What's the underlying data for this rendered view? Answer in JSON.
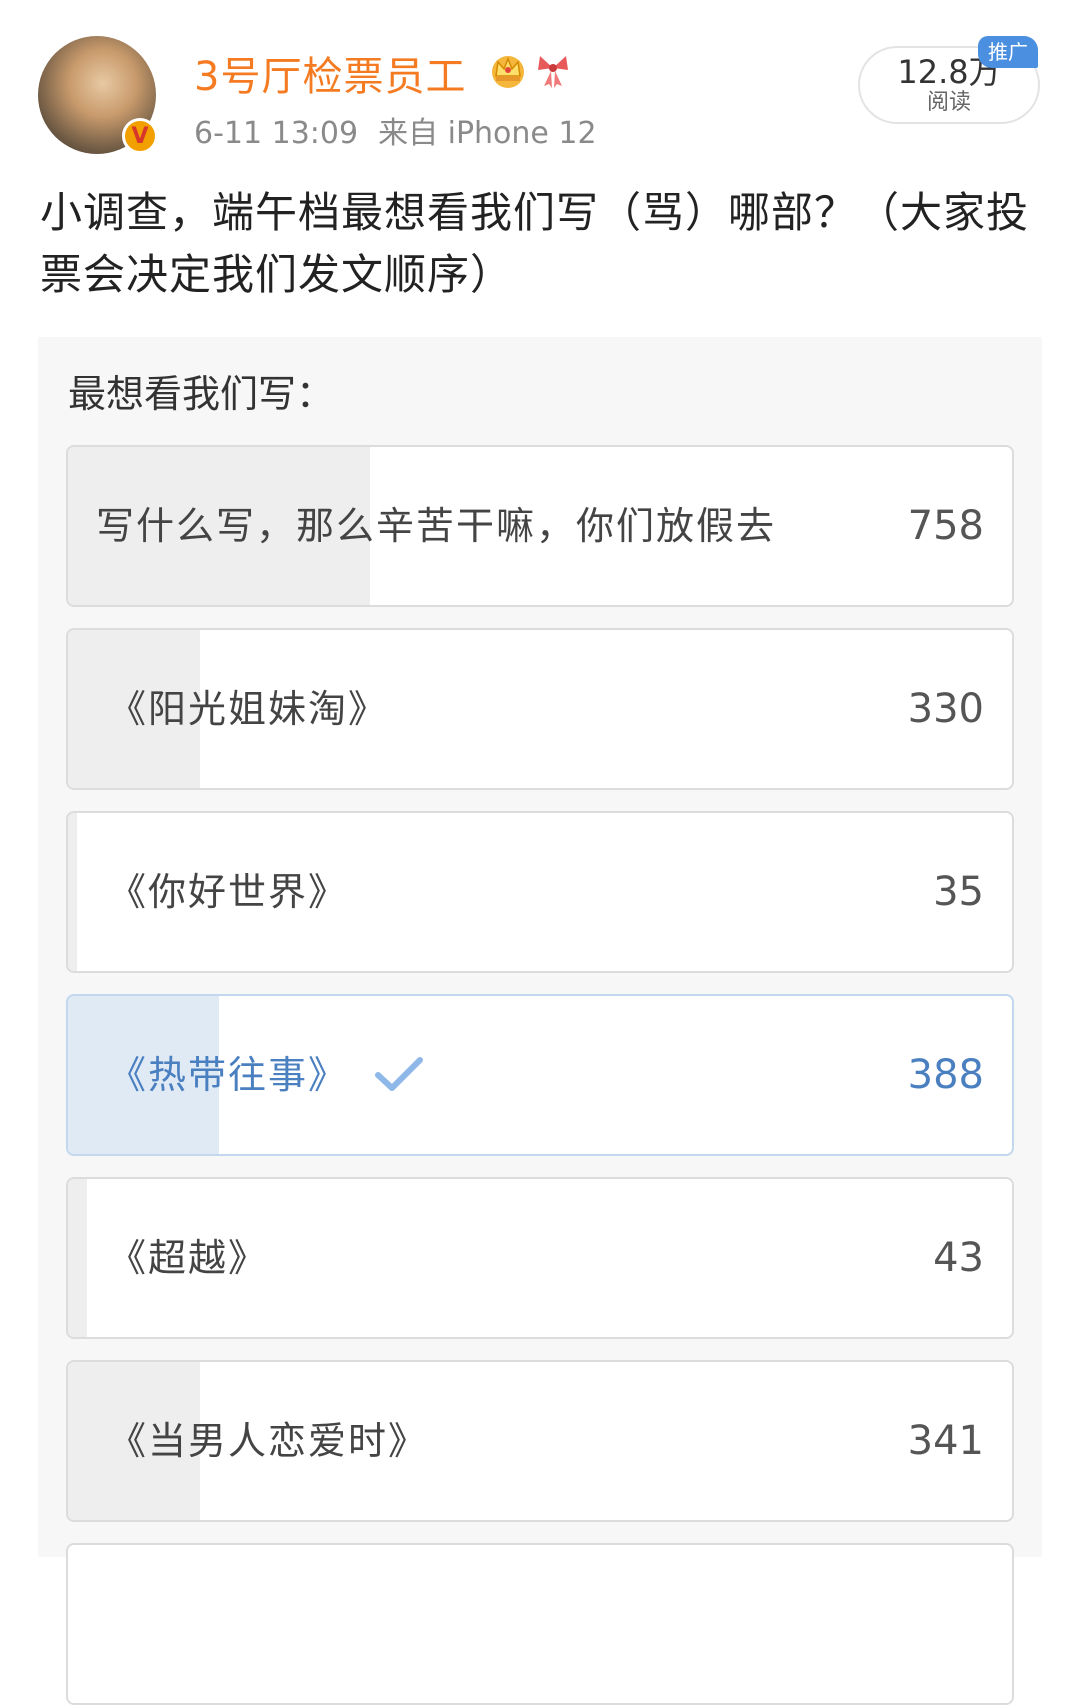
{
  "post": {
    "username": "3号厅检票员工",
    "date": "6-11 13:09",
    "source": "来自 iPhone 12",
    "reads": "12.8万",
    "reads_label": "阅读",
    "promo_tag": "推广",
    "text": "小调查，端午档最想看我们写（骂）哪部？（大家投票会决定我们发文顺序）",
    "verified_badge": "V"
  },
  "poll": {
    "title": "最想看我们写：",
    "options": [
      {
        "label": "写什么写，那么辛苦干嘛，你们放假去",
        "votes": "758",
        "share": 0.32,
        "selected": false
      },
      {
        "label": "《阳光姐妹淘》",
        "votes": "330",
        "share": 0.14,
        "selected": false
      },
      {
        "label": "《你好世界》",
        "votes": "35",
        "share": 0.01,
        "selected": false
      },
      {
        "label": "《热带往事》",
        "votes": "388",
        "share": 0.16,
        "selected": true
      },
      {
        "label": "《超越》",
        "votes": "43",
        "share": 0.02,
        "selected": false
      },
      {
        "label": "《当男人恋爱时》",
        "votes": "341",
        "share": 0.14,
        "selected": false
      }
    ]
  },
  "colors": {
    "username": "#f47b22",
    "selected_accent": "#4a7fc0",
    "promo_bg": "#4a8fe0"
  },
  "icons": [
    "verified-badge-icon",
    "crown-icon",
    "ribbon-icon",
    "check-icon"
  ]
}
